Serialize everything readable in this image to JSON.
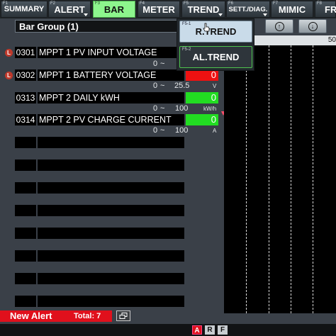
{
  "toolbar": {
    "buttons": [
      {
        "fkey": "F1",
        "label": "SUMMARY"
      },
      {
        "fkey": "F2",
        "label": "ALERT"
      },
      {
        "fkey": "F3",
        "label": "BAR"
      },
      {
        "fkey": "F4",
        "label": "METER"
      },
      {
        "fkey": "F5",
        "label": "TREND"
      },
      {
        "fkey": "F6",
        "label": "SETT./DIAG."
      },
      {
        "fkey": "F7",
        "label": "MIMIC"
      },
      {
        "fkey": "F8",
        "label": "FR"
      }
    ],
    "active_color": "#8df58d"
  },
  "group": {
    "title": "Bar Group (1)"
  },
  "nav": {
    "up_icon": "arrow-up-circle-icon",
    "down_icon": "arrow-down-circle-icon"
  },
  "rows": [
    {
      "badge": "L",
      "tag": "0301",
      "name": "MPPT 1 PV INPUT VOLTAGE",
      "value": "",
      "range_min": "0",
      "range_sep": "~",
      "range_max": "",
      "unit": ""
    },
    {
      "badge": "L",
      "tag": "0302",
      "name": "MPPT 1 BATTERY VOLTAGE",
      "value": "0",
      "range_min": "0",
      "range_sep": "~",
      "range_max": "25.5",
      "unit": "V"
    },
    {
      "badge": "",
      "tag": "0313",
      "name": "MPPT 2 DAILY kWH",
      "value": "0",
      "range_min": "0",
      "range_sep": "~",
      "range_max": "100",
      "unit": "kW/h"
    },
    {
      "badge": "",
      "tag": "0314",
      "name": "MPPT 2 PV CHARGE CURRENT",
      "value": "0",
      "range_min": "0",
      "range_sep": "~",
      "range_max": "100",
      "unit": "A"
    }
  ],
  "colors": {
    "alarm": "#ee1111",
    "normal": "#22dd22"
  },
  "trend_menu": {
    "items": [
      {
        "fkey": "F5-1",
        "label": "R.TREND"
      },
      {
        "fkey": "F5-2",
        "label": "AL.TREND"
      }
    ]
  },
  "chart": {
    "scale_label": "50"
  },
  "alert_bar": {
    "label": "New Alert",
    "total": "Total: 7"
  },
  "status": {
    "a": "A",
    "r": "R",
    "f": "F"
  }
}
